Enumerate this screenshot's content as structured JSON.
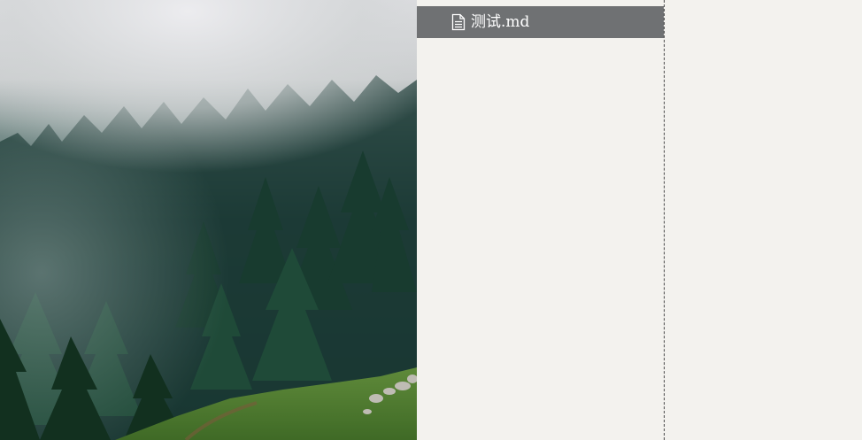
{
  "sidebar": {
    "files": [
      {
        "label": "测试.md",
        "icon": "file-text-icon",
        "selected": true
      }
    ]
  },
  "colors": {
    "background": "#f3f2ee",
    "selected_item": "#6f7173",
    "divider": "#4a4a4a"
  }
}
